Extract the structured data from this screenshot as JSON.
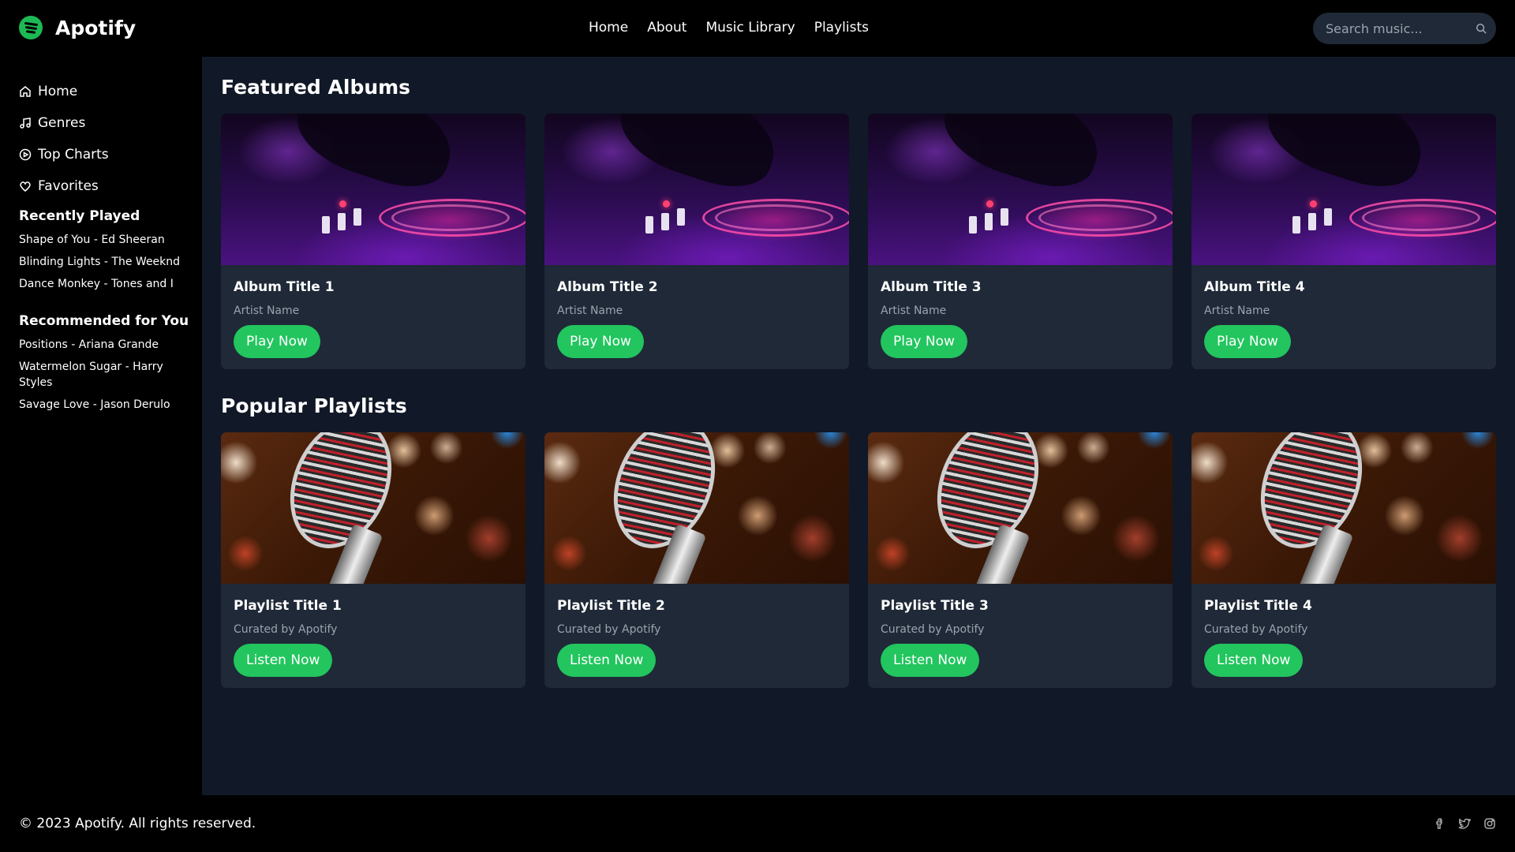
{
  "header": {
    "logo_text": "Apotify",
    "nav": [
      "Home",
      "About",
      "Music Library",
      "Playlists"
    ],
    "search_placeholder": "Search music..."
  },
  "sidebar": {
    "items": [
      {
        "label": "Home",
        "icon": "home-icon"
      },
      {
        "label": "Genres",
        "icon": "music-note-icon"
      },
      {
        "label": "Top Charts",
        "icon": "play-circle-icon"
      },
      {
        "label": "Favorites",
        "icon": "heart-icon"
      }
    ],
    "recently_played": {
      "title": "Recently Played",
      "items": [
        "Shape of You - Ed Sheeran",
        "Blinding Lights - The Weeknd",
        "Dance Monkey - Tones and I"
      ]
    },
    "recommended": {
      "title": "Recommended for You",
      "items": [
        "Positions - Ariana Grande",
        "Watermelon Sugar - Harry Styles",
        "Savage Love - Jason Derulo"
      ]
    }
  },
  "main": {
    "featured": {
      "title": "Featured Albums",
      "cards": [
        {
          "title": "Album Title 1",
          "subtitle": "Artist Name",
          "button": "Play Now"
        },
        {
          "title": "Album Title 2",
          "subtitle": "Artist Name",
          "button": "Play Now"
        },
        {
          "title": "Album Title 3",
          "subtitle": "Artist Name",
          "button": "Play Now"
        },
        {
          "title": "Album Title 4",
          "subtitle": "Artist Name",
          "button": "Play Now"
        }
      ]
    },
    "playlists": {
      "title": "Popular Playlists",
      "cards": [
        {
          "title": "Playlist Title 1",
          "subtitle": "Curated by Apotify",
          "button": "Listen Now"
        },
        {
          "title": "Playlist Title 2",
          "subtitle": "Curated by Apotify",
          "button": "Listen Now"
        },
        {
          "title": "Playlist Title 3",
          "subtitle": "Curated by Apotify",
          "button": "Listen Now"
        },
        {
          "title": "Playlist Title 4",
          "subtitle": "Curated by Apotify",
          "button": "Listen Now"
        }
      ]
    }
  },
  "footer": {
    "copyright": "© 2023 Apotify. All rights reserved.",
    "socials": [
      "facebook-icon",
      "twitter-icon",
      "instagram-icon"
    ]
  },
  "colors": {
    "accent": "#1db954",
    "button": "#22c55e",
    "main_bg": "#111827",
    "card_bg": "#1f2937"
  }
}
